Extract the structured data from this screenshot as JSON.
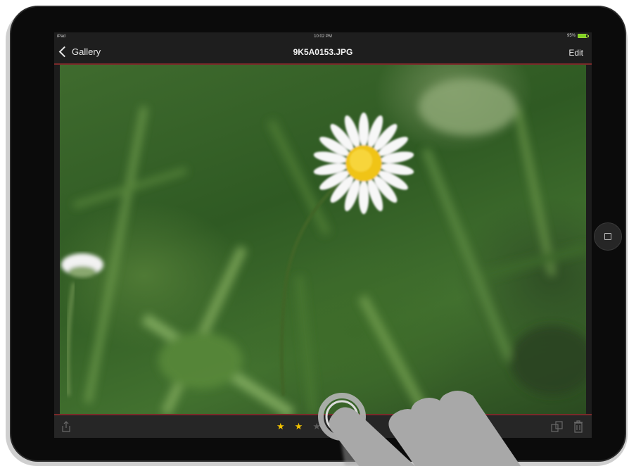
{
  "status_bar": {
    "carrier": "iPad",
    "time": "10:02 PM",
    "battery_text": "95%",
    "battery_level": 0.95
  },
  "nav": {
    "back_label": "Gallery",
    "title": "9K5A0153.JPG",
    "edit_label": "Edit"
  },
  "toolbar": {
    "rating_filled": 2,
    "rating_max": 5,
    "star_glyph": "★",
    "icons": [
      "share-icon",
      "copy-icon",
      "trash-icon"
    ]
  },
  "colors": {
    "accent_line": "#7a2a2a",
    "star": "#f2c200",
    "battery": "#7ed321"
  }
}
